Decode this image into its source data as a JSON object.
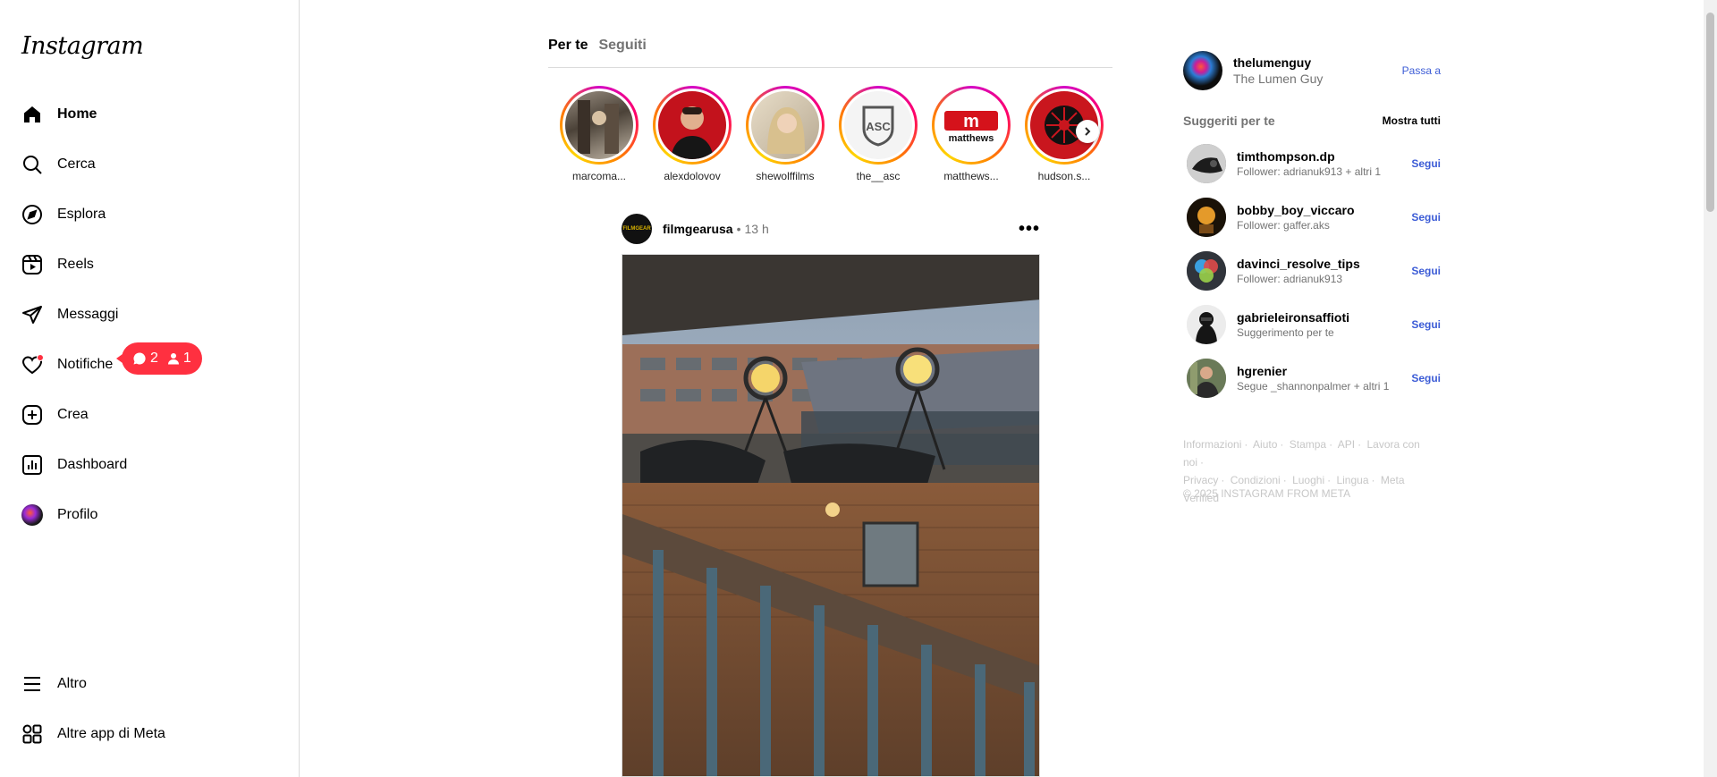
{
  "app": {
    "logo_text": "Instagram"
  },
  "sidebar": {
    "items": [
      {
        "label": "Home",
        "icon": "home-icon"
      },
      {
        "label": "Cerca",
        "icon": "search-icon"
      },
      {
        "label": "Esplora",
        "icon": "compass-icon"
      },
      {
        "label": "Reels",
        "icon": "reels-icon"
      },
      {
        "label": "Messaggi",
        "icon": "paper-plane-icon"
      },
      {
        "label": "Notifiche",
        "icon": "heart-icon"
      },
      {
        "label": "Crea",
        "icon": "plus-square-icon"
      },
      {
        "label": "Dashboard",
        "icon": "chart-icon"
      },
      {
        "label": "Profilo",
        "icon": "avatar-icon"
      }
    ],
    "bottom": [
      {
        "label": "Altro",
        "icon": "menu-icon"
      },
      {
        "label": "Altre app di Meta",
        "icon": "apps-grid-icon"
      }
    ],
    "notifications_badge": {
      "comments": "2",
      "followers": "1"
    }
  },
  "feed": {
    "tabs": [
      "Per te",
      "Seguiti"
    ],
    "stories": [
      {
        "name": "marcoma..."
      },
      {
        "name": "alexdolovov"
      },
      {
        "name": "shewolffilms"
      },
      {
        "name": "the__asc"
      },
      {
        "name": "matthews..."
      },
      {
        "name": "hudson.s..."
      }
    ],
    "post": {
      "username": "filmgearusa",
      "separator": "•",
      "time": "13 h",
      "avatar_text": "FILMGEAR"
    }
  },
  "right": {
    "me": {
      "username": "thelumenguy",
      "full_name": "The Lumen Guy",
      "switch_label": "Passa a"
    },
    "suggestions_title": "Suggeriti per te",
    "see_all": "Mostra tutti",
    "suggestions": [
      {
        "username": "timthompson.dp",
        "subtitle": "Follower: adrianuk913 + altri 1",
        "action": "Segui"
      },
      {
        "username": "bobby_boy_viccaro",
        "subtitle": "Follower: gaffer.aks",
        "action": "Segui"
      },
      {
        "username": "davinci_resolve_tips",
        "subtitle": "Follower: adrianuk913",
        "action": "Segui"
      },
      {
        "username": "gabrieleironsaffioti",
        "subtitle": "Suggerimento per te",
        "action": "Segui"
      },
      {
        "username": "hgrenier",
        "subtitle": "Segue _shannonpalmer + altri 1",
        "action": "Segui"
      }
    ],
    "footer_links_row1": [
      "Informazioni",
      "Aiuto",
      "Stampa",
      "API",
      "Lavora con noi"
    ],
    "footer_links_row2": [
      "Privacy",
      "Condizioni",
      "Luoghi",
      "Lingua",
      "Meta Verified"
    ],
    "copyright": "© 2025 INSTAGRAM FROM META"
  },
  "colors": {
    "accent": "#3c5cd6",
    "badge": "#ff3040",
    "muted": "#737373"
  }
}
